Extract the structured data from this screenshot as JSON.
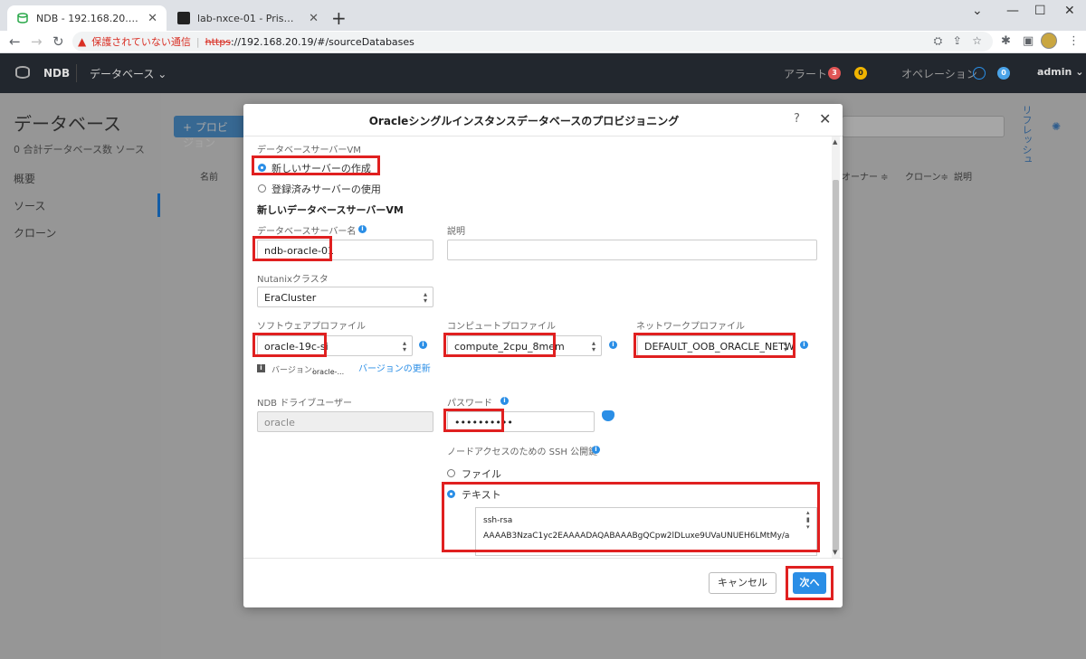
{
  "browser": {
    "tabs": [
      {
        "title": "NDB - 192.168.20.19 - データベース"
      },
      {
        "title": "lab-nxce-01 - Prism Element"
      }
    ],
    "new_tab": "+",
    "insecure_label": "保護されていない通信",
    "url_scheme": "https",
    "url_rest": "://192.168.20.19/#/sourceDatabases"
  },
  "app": {
    "brand": "NDB",
    "menu": "データベース ⌄",
    "alert_label": "アラート",
    "alert_red": "3",
    "alert_orange": "0",
    "operation_label": "オペレーション",
    "operation_count": "0",
    "user": "admin ⌄",
    "colors": {
      "accent": "#2a8ee6",
      "highlight": "#e02020",
      "header": "#22272e"
    }
  },
  "sidebar": {
    "title": "データベース",
    "subtitle": "0 合計データベース数 ソース",
    "items": [
      {
        "label": "概要"
      },
      {
        "label": "ソース"
      },
      {
        "label": "クローン"
      }
    ]
  },
  "background": {
    "provision_button": "+ プロビ ジョン",
    "refresh": "リフレッシュ",
    "columns": {
      "name": "名前",
      "owner": "オーナー ≑",
      "clone": "クローン≑",
      "desc": "説明"
    }
  },
  "modal": {
    "title": "Oracleシングルインスタンスデータベースのプロビジョニング",
    "help": "?",
    "close": "✕",
    "section_label": "データベースサーバーVM",
    "radio_new": "新しいサーバーの作成",
    "radio_existing": "登録済みサーバーの使用",
    "new_vm_heading": "新しいデータベースサーバーVM",
    "server_name_label": "データベースサーバー名",
    "server_name_value": "ndb-oracle-01",
    "description_label": "説明",
    "description_value": "",
    "cluster_label": "Nutanixクラスタ",
    "cluster_value": "EraCluster",
    "software_label": "ソフトウェアプロファイル",
    "software_value": "oracle-19c-si",
    "compute_label": "コンピュートプロファイル",
    "compute_value": "compute_2cpu_8mem",
    "network_label": "ネットワークプロファイル",
    "network_value": "DEFAULT_OOB_ORACLE_NETW",
    "version_label": "バージョン:",
    "version_value": "oracle-...",
    "version_update": "バージョンの更新",
    "drive_user_label": "NDB ドライブユーザー",
    "drive_user_value": "oracle",
    "password_label": "パスワード",
    "password_value": "••••••••••",
    "ssh_label": "ノードアクセスのための SSH 公開鍵",
    "ssh_file": "ファイル",
    "ssh_text": "テキスト",
    "ssh_key_line1": "ssh-rsa",
    "ssh_key_line2": "AAAAB3NzaC1yc2EAAAADAQABAAABgQCpw2lDLuxe9UVaUNUEH6LMtMy/a",
    "cancel": "キャンセル",
    "next": "次へ"
  }
}
